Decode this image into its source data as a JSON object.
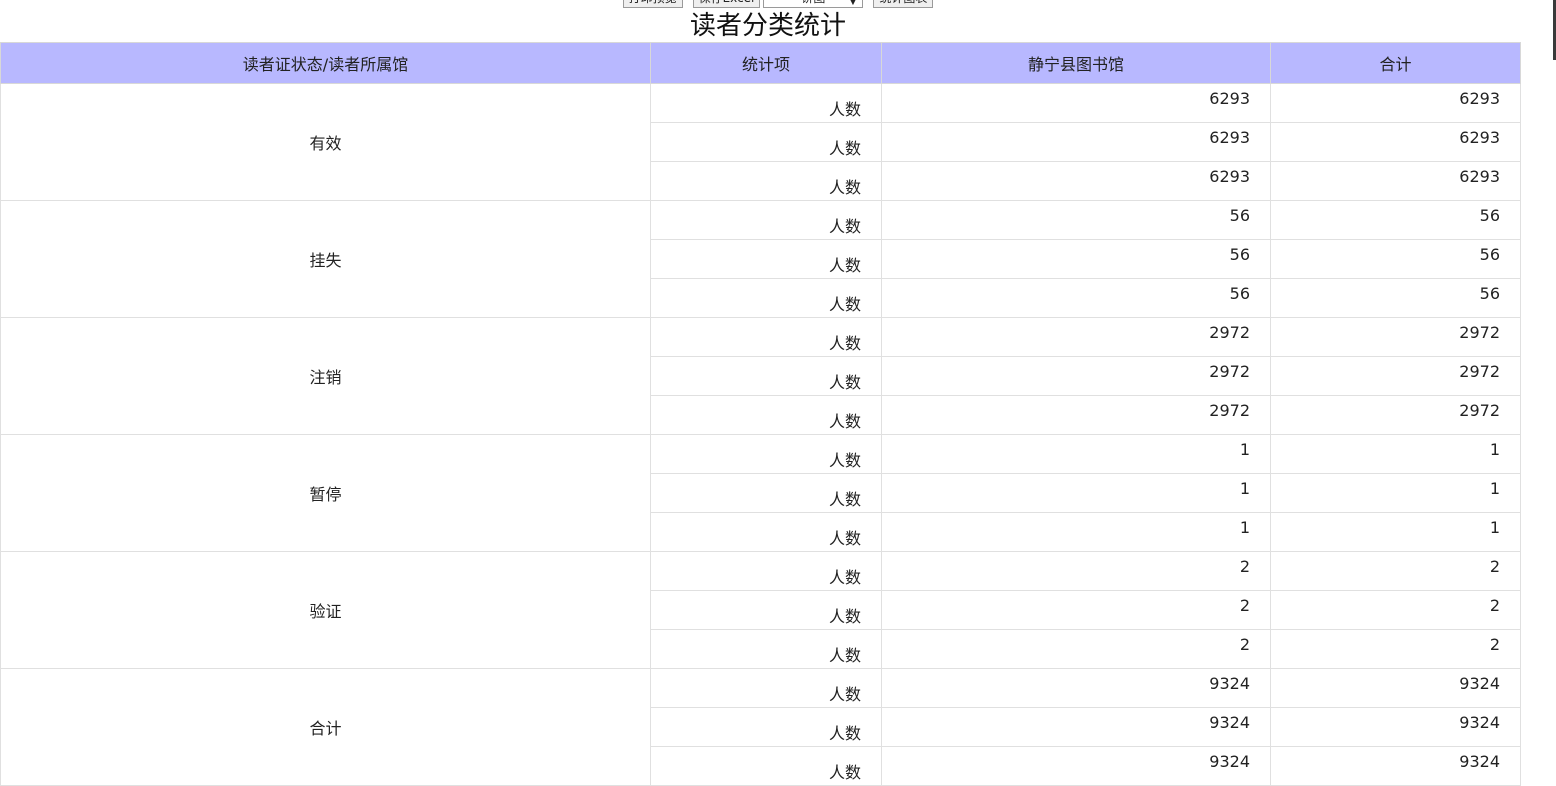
{
  "toolbar": {
    "print_preview": "打印预览",
    "save_excel": "保存Excel",
    "view_select": "饼图",
    "stat_chart": "统计图表"
  },
  "title": "读者分类统计",
  "table": {
    "headers": [
      "读者证状态/读者所属馆",
      "统计项",
      "静宁县图书馆",
      "合计"
    ],
    "groups": [
      {
        "label": "有效",
        "rows": [
          {
            "item": "人数",
            "library": "6293",
            "total": "6293"
          },
          {
            "item": "人数",
            "library": "6293",
            "total": "6293"
          },
          {
            "item": "人数",
            "library": "6293",
            "total": "6293"
          }
        ]
      },
      {
        "label": "挂失",
        "rows": [
          {
            "item": "人数",
            "library": "56",
            "total": "56"
          },
          {
            "item": "人数",
            "library": "56",
            "total": "56"
          },
          {
            "item": "人数",
            "library": "56",
            "total": "56"
          }
        ]
      },
      {
        "label": "注销",
        "rows": [
          {
            "item": "人数",
            "library": "2972",
            "total": "2972"
          },
          {
            "item": "人数",
            "library": "2972",
            "total": "2972"
          },
          {
            "item": "人数",
            "library": "2972",
            "total": "2972"
          }
        ]
      },
      {
        "label": "暂停",
        "rows": [
          {
            "item": "人数",
            "library": "1",
            "total": "1"
          },
          {
            "item": "人数",
            "library": "1",
            "total": "1"
          },
          {
            "item": "人数",
            "library": "1",
            "total": "1"
          }
        ]
      },
      {
        "label": "验证",
        "rows": [
          {
            "item": "人数",
            "library": "2",
            "total": "2"
          },
          {
            "item": "人数",
            "library": "2",
            "total": "2"
          },
          {
            "item": "人数",
            "library": "2",
            "total": "2"
          }
        ]
      },
      {
        "label": "合计",
        "rows": [
          {
            "item": "人数",
            "library": "9324",
            "total": "9324"
          },
          {
            "item": "人数",
            "library": "9324",
            "total": "9324"
          },
          {
            "item": "人数",
            "library": "9324",
            "total": "9324"
          }
        ]
      }
    ]
  },
  "colors": {
    "header_bg": "#b8b8ff",
    "border": "#e0e0e0"
  }
}
